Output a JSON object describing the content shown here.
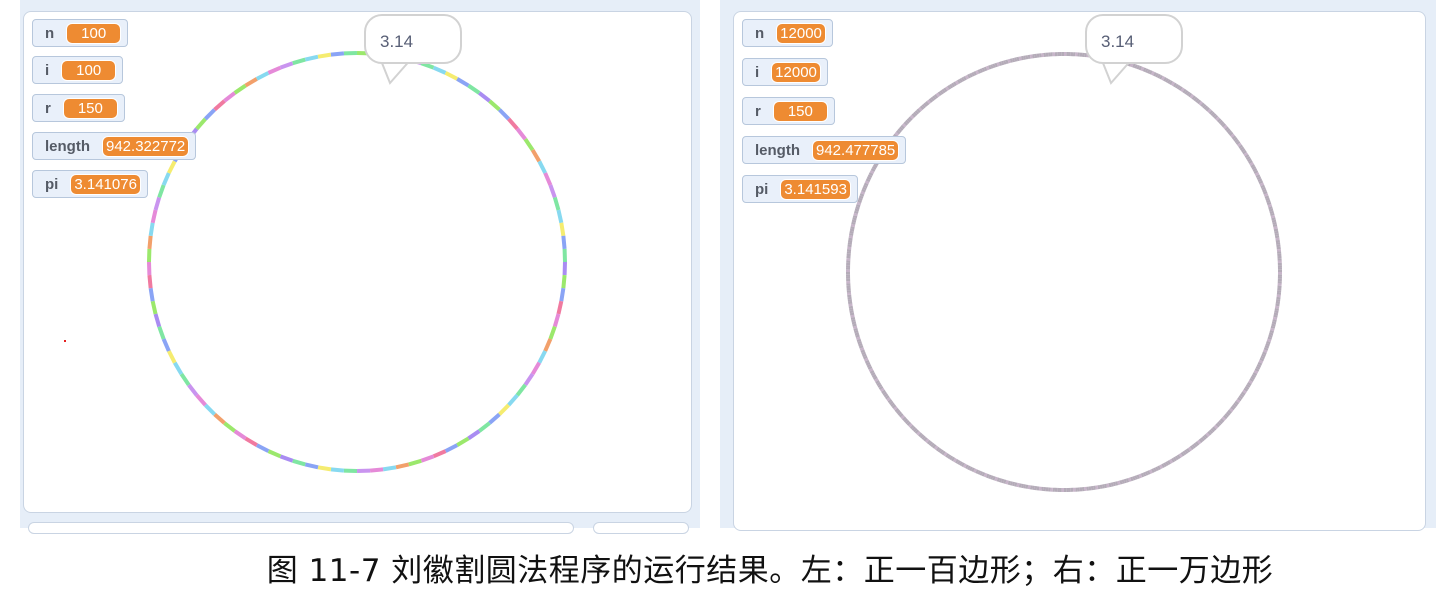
{
  "left": {
    "monitors": [
      {
        "label": "n",
        "value": "100"
      },
      {
        "label": "i",
        "value": "100"
      },
      {
        "label": "r",
        "value": "150"
      },
      {
        "label": "length",
        "value": "942.322772"
      },
      {
        "label": "pi",
        "value": "3.141076"
      }
    ],
    "bubble_text": "3.14",
    "polygon_sides": 100
  },
  "right": {
    "monitors": [
      {
        "label": "n",
        "value": "12000"
      },
      {
        "label": "i",
        "value": "12000"
      },
      {
        "label": "r",
        "value": "150"
      },
      {
        "label": "length",
        "value": "942.477785"
      },
      {
        "label": "pi",
        "value": "3.141593"
      }
    ],
    "bubble_text": "3.14",
    "polygon_sides": 12000
  },
  "colors": {
    "stage_border": "#c9d4e3",
    "monitor_value_bg": "#ee8b32",
    "left_pen_palette": [
      "#9be86c",
      "#f5ec70",
      "#e58ad8",
      "#a98cf2",
      "#87d9f0",
      "#f07aa0",
      "#7fe6a2",
      "#f2a06b",
      "#8aa4f5",
      "#c994ef"
    ],
    "right_pen_color": "#b4abb8"
  },
  "caption": "图 11-7 刘徽割圆法程序的运行结果。左：正一百边形；右：正一万边形"
}
